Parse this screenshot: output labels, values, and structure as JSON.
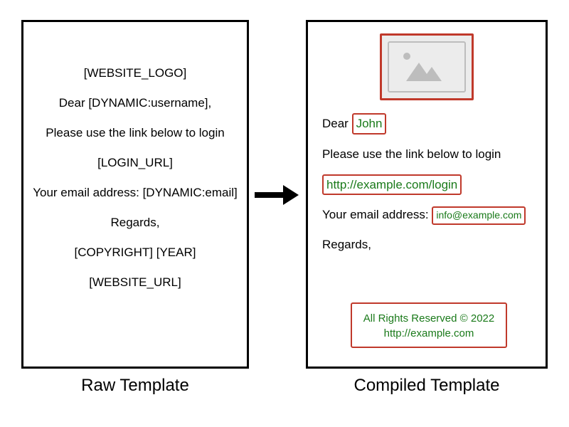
{
  "left": {
    "title": "Raw Template",
    "lines": [
      "[WEBSITE_LOGO]",
      "Dear [DYNAMIC:username],",
      "Please use the link below to login",
      "[LOGIN_URL]",
      "Your email address: [DYNAMIC:email]",
      "Regards,",
      "[COPYRIGHT] [YEAR]",
      "[WEBSITE_URL]"
    ]
  },
  "right": {
    "title": "Compiled Template",
    "dear_prefix": "Dear",
    "username": "John",
    "body_line": "Please use the link below to login",
    "login_url": "http://example.com/login",
    "email_prefix": "Your email address:",
    "email": "info@example.com",
    "regards": "Regards,",
    "footer_copyright": "All Rights Reserved © 2022",
    "footer_url": "http://example.com"
  }
}
